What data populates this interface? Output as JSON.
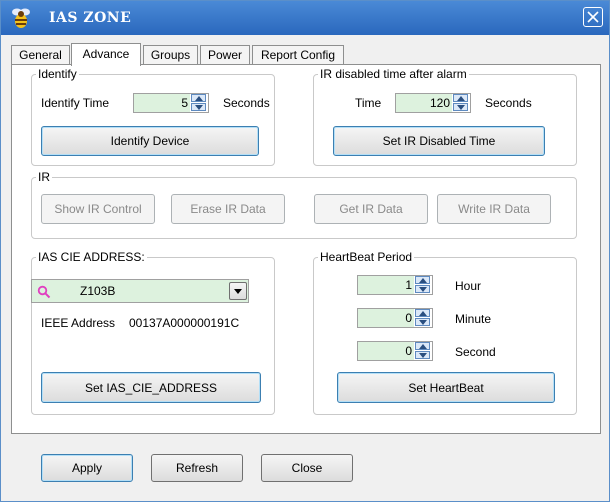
{
  "window": {
    "title": "IAS ZONE"
  },
  "tabs": [
    {
      "label": "General",
      "active": false
    },
    {
      "label": "Advance",
      "active": true
    },
    {
      "label": "Groups",
      "active": false
    },
    {
      "label": "Power",
      "active": false
    },
    {
      "label": "Report Config",
      "active": false
    }
  ],
  "identify": {
    "legend": "Identify",
    "time_label": "Identify Time",
    "time_value": "5",
    "units": "Seconds",
    "button": "Identify Device"
  },
  "ir_disabled": {
    "legend": "IR disabled time after alarm",
    "time_label": "Time",
    "time_value": "120",
    "units": "Seconds",
    "button": "Set IR Disabled Time"
  },
  "ir": {
    "legend": "IR",
    "buttons": [
      "Show IR Control",
      "Erase IR Data",
      "Get IR Data",
      "Write IR Data"
    ]
  },
  "ias_cie": {
    "legend": "IAS CIE ADDRESS:",
    "combo_value": "Z103B",
    "ieee_label": "IEEE Address",
    "ieee_value": "00137A000000191C",
    "button": "Set IAS_CIE_ADDRESS"
  },
  "heartbeat": {
    "legend": "HeartBeat Period",
    "hour_value": "1",
    "hour_label": "Hour",
    "minute_value": "0",
    "minute_label": "Minute",
    "second_value": "0",
    "second_label": "Second",
    "button": "Set HeartBeat"
  },
  "footer": {
    "apply": "Apply",
    "refresh": "Refresh",
    "close": "Close"
  },
  "colors": {
    "titlebar": "#2f73c8",
    "field_bg": "#ddf2de",
    "search_icon": "#e040c0"
  },
  "icons": {
    "app": "bee-icon",
    "close": "close-icon",
    "search": "search-icon"
  }
}
